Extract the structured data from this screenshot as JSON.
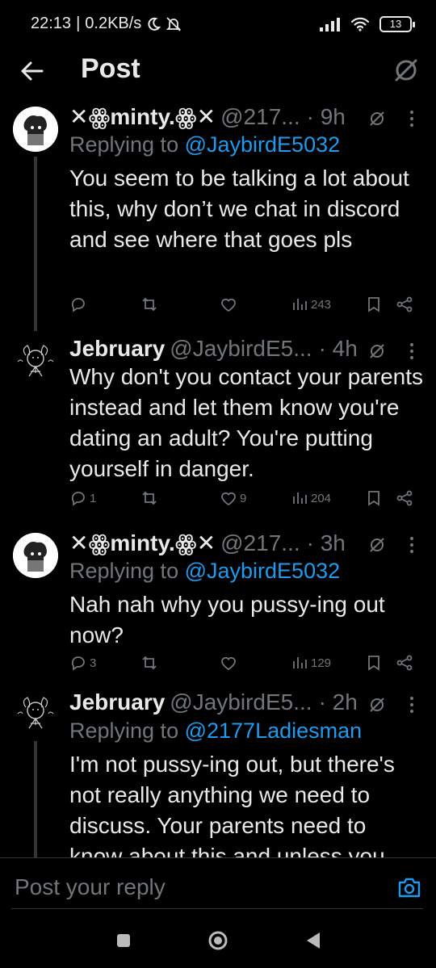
{
  "status_bar": {
    "time": "22:13",
    "speed": "0.2KB/s",
    "battery": "13"
  },
  "header": {
    "title": "Post"
  },
  "tweets": [
    {
      "name": "✕ꙮminty.ꙮ✕",
      "handle": "@217...",
      "time": "· 9h",
      "replying_prefix": "Replying to ",
      "replying_to": "@JaybirdE5032",
      "body": "You seem to be talking a lot about this, why don’t we chat in discord and see where that goes pls",
      "replies": "",
      "likes": "",
      "views": "243"
    },
    {
      "name": "Jebruary",
      "handle": "@JaybirdE5...",
      "time": "· 4h",
      "body": "Why don't you contact your parents instead and let them know you're dating an adult? You're putting yourself in danger.",
      "replies": "1",
      "likes": "9",
      "views": "204"
    },
    {
      "name": "✕ꙮminty.ꙮ✕",
      "handle": "@217...",
      "time": "· 3h",
      "replying_prefix": "Replying to ",
      "replying_to": "@JaybirdE5032",
      "body": "Nah nah why you pussy-ing out now?",
      "replies": "3",
      "likes": "",
      "views": "129"
    },
    {
      "name": "Jebruary",
      "handle": "@JaybirdE5...",
      "time": "· 2h",
      "replying_prefix": "Replying to ",
      "replying_to": "@2177Ladiesman",
      "body": "I'm not pussy-ing out, but there's not really anything we need to discuss. Your parents need to know about this and unless you"
    }
  ],
  "reply_bar": {
    "placeholder": "Post your reply"
  },
  "colors": {
    "background": "#000000",
    "text": "#e7e9ea",
    "muted": "#71767b",
    "accent": "#1d9bf0"
  }
}
